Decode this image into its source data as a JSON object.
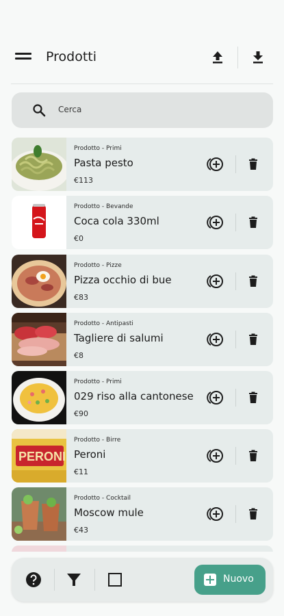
{
  "header": {
    "title": "Prodotti",
    "menu_icon": "menu-icon",
    "upload_icon": "upload-icon",
    "download_icon": "download-icon"
  },
  "search": {
    "placeholder": "Cerca",
    "icon": "search-icon"
  },
  "products": [
    {
      "category": "Prodotto - Primi",
      "name": "Pasta pesto",
      "price": "€113",
      "image": "pasta-pesto"
    },
    {
      "category": "Prodotto - Bevande",
      "name": "Coca cola 330ml",
      "price": "€0",
      "image": "coca-cola-can"
    },
    {
      "category": "Prodotto - Pizze",
      "name": "Pizza occhio di bue",
      "price": "€83",
      "image": "pizza"
    },
    {
      "category": "Prodotto - Antipasti",
      "name": "Tagliere di salumi",
      "price": "€8",
      "image": "cold-cuts"
    },
    {
      "category": "Prodotto - Primi",
      "name": "029 riso alla cantonese",
      "price": "€90",
      "image": "fried-rice"
    },
    {
      "category": "Prodotto - Birre",
      "name": "Peroni",
      "price": "€11",
      "image": "peroni-beer"
    },
    {
      "category": "Prodotto - Cocktail",
      "name": "Moscow mule",
      "price": "€43",
      "image": "moscow-mule"
    }
  ],
  "bottom_bar": {
    "help_icon": "help-icon",
    "filter_icon": "filter-icon",
    "select_icon": "checkbox-icon",
    "new_label": "Nuovo"
  },
  "colors": {
    "accent": "#47a08a",
    "card_background": "#e6eceb",
    "page_background": "#f7f9f8"
  }
}
